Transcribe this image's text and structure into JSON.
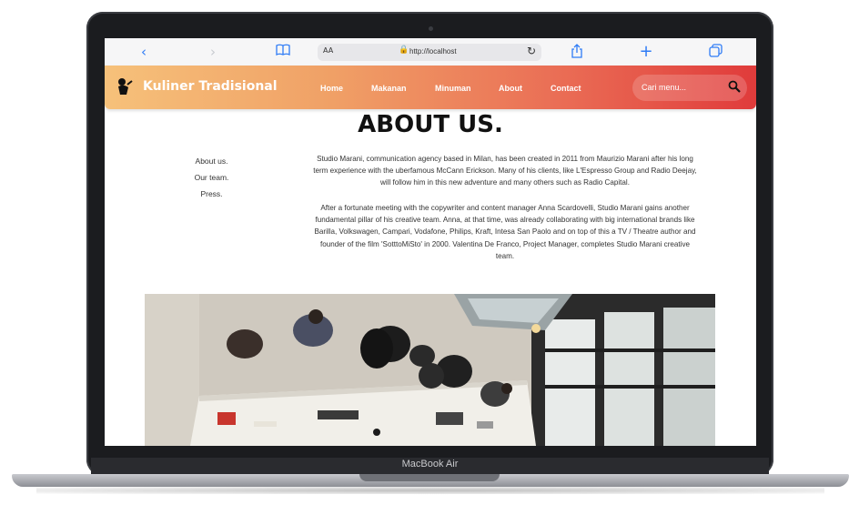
{
  "device": {
    "label": "MacBook Air"
  },
  "browser": {
    "address_prefix": "AA",
    "url": "http://localhost"
  },
  "site": {
    "brand": "Kuliner Tradisional",
    "nav": [
      "Home",
      "Makanan",
      "Minuman",
      "About",
      "Contact"
    ],
    "search_placeholder": "Cari menu..."
  },
  "about": {
    "title": "ABOUT US.",
    "side_links": [
      "About us.",
      "Our team.",
      "Press."
    ],
    "paragraph_1_lines": [
      "Studio Marani, communication agency based in Milan, has been created in 2011 from Maurizio Marani after his long",
      "term experience with the uberfamous McCann Erickson. Many of his clients, like L'Espresso Group and Radio Deejay,",
      "will follow him in this new adventure and many others such as Radio Capital."
    ],
    "paragraph_2_lines": [
      "After a fortunate meeting with the copywriter and content manager Anna Scardovelli, Studio Marani gains another",
      "fundamental pillar of his creative team. Anna, at that time, was already collaborating with big international brands like",
      "Barilla, Volkswagen, Campari, Vodafone, Philips, Kraft, Intesa San Paolo and on top of this a TV / Theatre author and",
      "founder of the film 'SotttoMiSto' in 2000. Valentina De Franco, Project Manager, completes Studio Marani creative",
      "team."
    ]
  },
  "colors": {
    "nav_gradient_start": "#f6c17a",
    "nav_gradient_end": "#e03b3b",
    "safari_accent": "#2f7cf6"
  }
}
